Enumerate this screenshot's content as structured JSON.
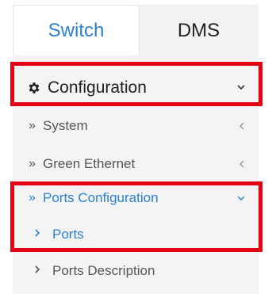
{
  "tabs": [
    {
      "label": "Switch",
      "active": true
    },
    {
      "label": "DMS",
      "active": false
    }
  ],
  "menu": {
    "section": {
      "label": "Configuration",
      "icon": "gear-icon",
      "expanded": true
    },
    "items": [
      {
        "label": "System",
        "expanded": false
      },
      {
        "label": "Green Ethernet",
        "expanded": false
      },
      {
        "label": "Ports Configuration",
        "expanded": true,
        "children": [
          {
            "label": "Ports",
            "active": true
          },
          {
            "label": "Ports Description",
            "active": false
          }
        ]
      }
    ]
  },
  "colors": {
    "accent_blue": "#2a7fd4",
    "text_dark": "#222222",
    "text_muted": "#555555",
    "caret_gray": "#9a9a9a",
    "highlight_red": "#e50014",
    "panel_bg": "#f4f4f4",
    "inactive_tab_bg": "#f2f2f2"
  }
}
